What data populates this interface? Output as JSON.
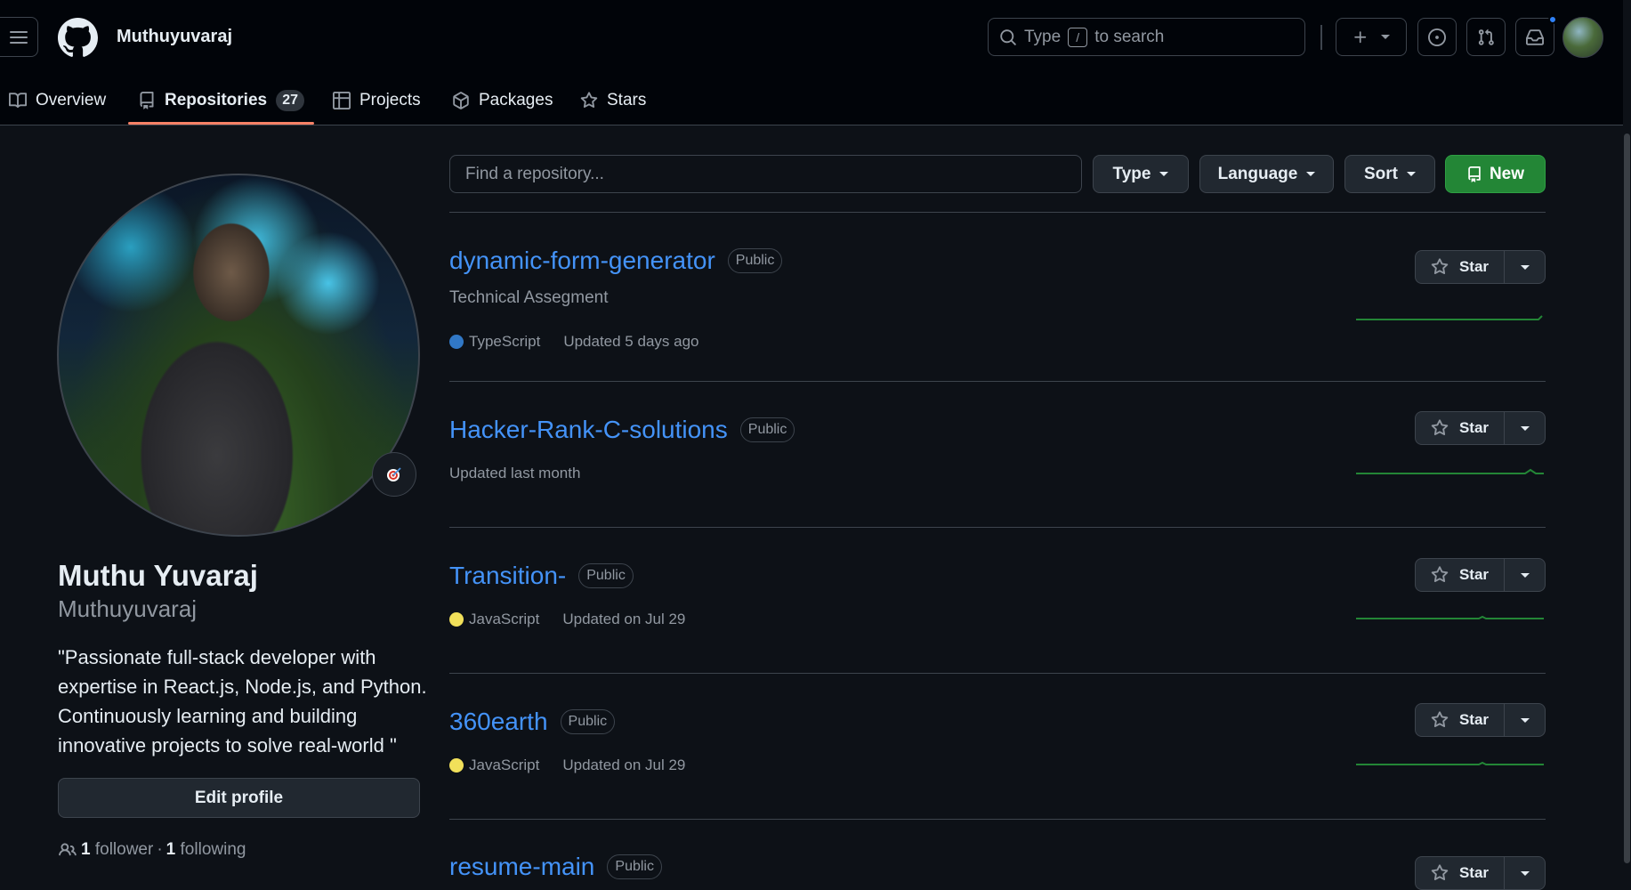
{
  "header": {
    "username": "Muthuyuvaraj",
    "search_prefix": "Type",
    "search_key": "/",
    "search_suffix": "to search"
  },
  "tabs": [
    {
      "label": "Overview",
      "icon": "book-icon"
    },
    {
      "label": "Repositories",
      "icon": "repo-icon",
      "count": "27",
      "active": true
    },
    {
      "label": "Projects",
      "icon": "table-icon"
    },
    {
      "label": "Packages",
      "icon": "package-icon"
    },
    {
      "label": "Stars",
      "icon": "star-icon"
    }
  ],
  "profile": {
    "full_name": "Muthu Yuvaraj",
    "login": "Muthuyuvaraj",
    "bio": "\"Passionate full-stack developer with expertise in React.js, Node.js, and Python. Continuously learning and building innovative projects to solve real-world \"",
    "edit_label": "Edit profile",
    "followers_count": "1",
    "followers_label": "follower",
    "separator": "·",
    "following_count": "1",
    "following_label": "following"
  },
  "filters": {
    "search_placeholder": "Find a repository...",
    "type_label": "Type",
    "language_label": "Language",
    "sort_label": "Sort",
    "new_label": "New"
  },
  "repos": [
    {
      "name": "dynamic-form-generator",
      "visibility": "Public",
      "description": "Technical Assegment",
      "language": "TypeScript",
      "language_color": "#3178c6",
      "updated": "Updated 5 days ago"
    },
    {
      "name": "Hacker-Rank-C-solutions",
      "visibility": "Public",
      "description": "",
      "language": "",
      "updated": "Updated last month"
    },
    {
      "name": "Transition-",
      "visibility": "Public",
      "description": "",
      "language": "JavaScript",
      "language_color": "#f1e05a",
      "updated": "Updated on Jul 29"
    },
    {
      "name": "360earth",
      "visibility": "Public",
      "description": "",
      "language": "JavaScript",
      "language_color": "#f1e05a",
      "updated": "Updated on Jul 29"
    },
    {
      "name": "resume-main",
      "visibility": "Public",
      "description": "",
      "language": "",
      "updated": ""
    }
  ],
  "star_label": "Star",
  "colors": {
    "background": "#0d1117",
    "header_bg": "#010409",
    "link": "#4493f8",
    "accent_underline": "#f78166",
    "new_button": "#238636",
    "sparkline": "#238636"
  }
}
